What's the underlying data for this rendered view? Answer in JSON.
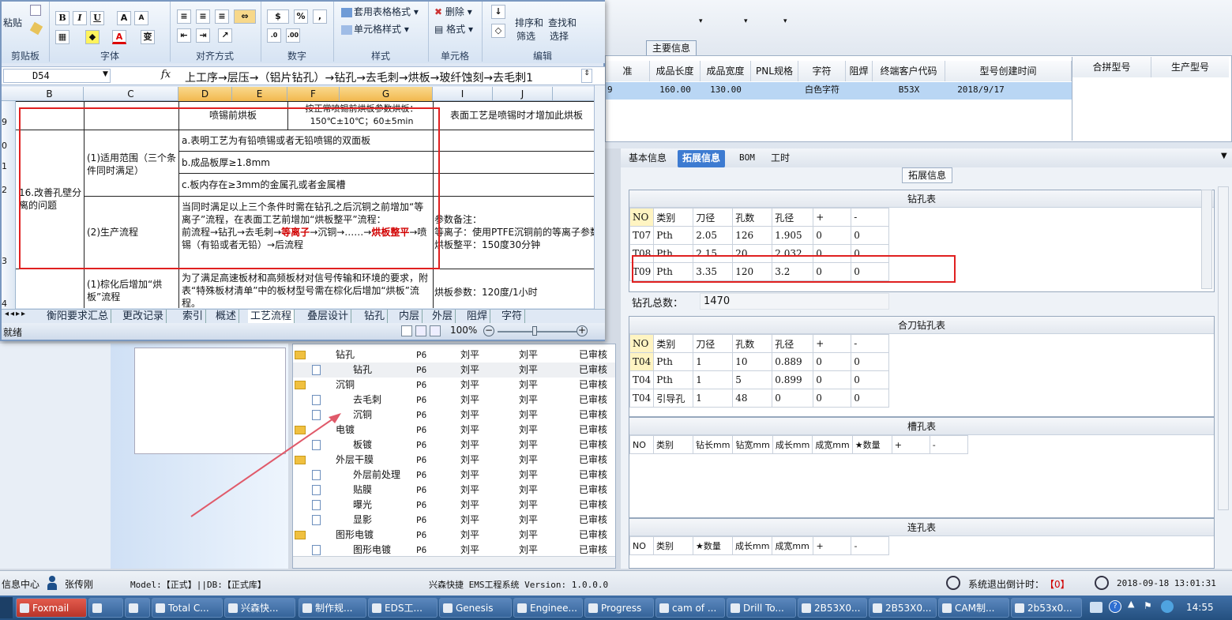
{
  "excel": {
    "ribbon": {
      "groups": [
        "剪贴板",
        "字体",
        "对齐方式",
        "数字",
        "样式",
        "单元格",
        "编辑"
      ],
      "paste_label": "粘贴",
      "table_format": "套用表格格式",
      "cell_style": "单元格样式",
      "delete": "删除",
      "format": "格式",
      "sort_filter_1": "排序和",
      "sort_filter_2": "筛选",
      "find_select_1": "查找和",
      "find_select_2": "选择"
    },
    "name_box": "D54",
    "formula": "上工序→层压→（铝片钻孔）→钻孔→去毛刺→烘板→玻纤蚀刻→去毛刺1",
    "columns": [
      "B",
      "C",
      "D",
      "E",
      "F",
      "G",
      "I",
      "J"
    ],
    "rows": [
      "9",
      "0",
      "1",
      "2",
      "3",
      "4"
    ],
    "cells": {
      "d9": "喷锡前烘板",
      "g9": "按正常喷锡前烘板参数烘板：150℃±10℃；60±5min",
      "i9": "表面工艺是喷锡时才增加此烘板",
      "b_item": "16.改善孔壁分离的问题",
      "c_scope": "(1)适用范围（三个条件同时满足）",
      "d_a": "a.表明工艺为有铅喷锡或者无铅喷锡的双面板",
      "d_b": "b.成品板厚≥1.8mm",
      "d_c": "c.板内存在≥3mm的金属孔或者金属槽",
      "c_flow": "(2)生产流程",
      "flow_text_1": "当同时满足以上三个条件时需在钻孔之后沉铜之前增加“等离子”流程，在表面工艺前增加“烘板整平”流程：",
      "flow_text_2a": "前流程→钻孔→去毛刺→",
      "flow_text_2b": "等离子",
      "flow_text_2c": "→沉铜→……→",
      "flow_text_2d": "烘板整平",
      "flow_text_2e": "→喷锡（有铅或者无铅）→后流程",
      "note": "参数备注：\n等离子：使用PTFE沉铜前的等离子参数\n烘板整平：150度30分钟",
      "c_next": "(1)棕化后增加“烘板”流程",
      "d_next": "为了满足高速板材和高频板材对信号传输和环境的要求，附表“特殊板材清单”中的板材型号需在棕化后增加“烘板”流程。",
      "i_next": "烘板参数：120度/1小时"
    },
    "sheet_tabs": [
      "衡阳要求汇总",
      "更改记录",
      "索引",
      "概述",
      "工艺流程",
      "叠层设计",
      "钻孔",
      "内层",
      "外层",
      "阻焊",
      "字符"
    ],
    "active_tab": "工艺流程",
    "status_left": "就绪",
    "zoom": "100%"
  },
  "ems": {
    "main_info_tab": "主要信息",
    "grid_headers": [
      "准",
      "成品长度",
      "成品宽度",
      "PNL规格",
      "字符",
      "阻焊",
      "终端客户代码",
      "型号创建时间"
    ],
    "grid_row": [
      "9",
      "160.00",
      "130.00",
      "",
      "白色字符",
      "",
      "B53X",
      "2018/9/17"
    ],
    "right_headers": [
      "合拼型号",
      "生产型号"
    ],
    "tabs": [
      "基本信息",
      "拓展信息",
      "BOM",
      "工时"
    ],
    "active_tab": "拓展信息",
    "ext_title": "拓展信息",
    "drill_table": {
      "title": "钻孔表",
      "headers": [
        "NO",
        "类别",
        "刀径",
        "孔数",
        "孔径",
        "+",
        "-"
      ],
      "rows": [
        [
          "T07",
          "Pth",
          "2.05",
          "126",
          "1.905",
          "0",
          "0"
        ],
        [
          "T08",
          "Pth",
          "2.15",
          "20",
          "2.032",
          "0",
          "0"
        ],
        [
          "T09",
          "Pth",
          "3.35",
          "120",
          "3.2",
          "0",
          "0"
        ]
      ]
    },
    "hole_total_label": "钻孔总数：",
    "hole_total_value": "1470",
    "combo_table": {
      "title": "合刀钻孔表",
      "headers": [
        "NO",
        "类别",
        "刀径",
        "孔数",
        "孔径",
        "+",
        "-"
      ],
      "rows": [
        [
          "T04",
          "Pth",
          "1",
          "10",
          "0.889",
          "0",
          "0"
        ],
        [
          "T04",
          "Pth",
          "1",
          "5",
          "0.899",
          "0",
          "0"
        ],
        [
          "T04",
          "引导孔",
          "1",
          "48",
          "0",
          "0",
          "0"
        ]
      ]
    },
    "slot_table": {
      "title": "槽孔表",
      "headers": [
        "NO",
        "类别",
        "钻长mm",
        "钻宽mm",
        "成长mm",
        "成宽mm",
        "★数量",
        "+",
        "-"
      ]
    },
    "link_table": {
      "title": "连孔表",
      "headers": [
        "NO",
        "类别",
        "★数量",
        "成长mm",
        "成宽mm",
        "+",
        "-"
      ]
    },
    "tree": [
      {
        "name": "钻孔",
        "folder": true,
        "indent": 1,
        "c1": "P6",
        "c2": "刘平",
        "c3": "刘平",
        "c4": "已审核"
      },
      {
        "name": "钻孔",
        "folder": false,
        "indent": 2,
        "c1": "P6",
        "c2": "刘平",
        "c3": "刘平",
        "c4": "已审核"
      },
      {
        "name": "沉铜",
        "folder": true,
        "indent": 1,
        "c1": "P6",
        "c2": "刘平",
        "c3": "刘平",
        "c4": "已审核"
      },
      {
        "name": "去毛刺",
        "folder": false,
        "indent": 2,
        "c1": "P6",
        "c2": "刘平",
        "c3": "刘平",
        "c4": "已审核"
      },
      {
        "name": "沉铜",
        "folder": false,
        "indent": 2,
        "c1": "P6",
        "c2": "刘平",
        "c3": "刘平",
        "c4": "已审核"
      },
      {
        "name": "电镀",
        "folder": true,
        "indent": 1,
        "c1": "P6",
        "c2": "刘平",
        "c3": "刘平",
        "c4": "已审核"
      },
      {
        "name": "板镀",
        "folder": false,
        "indent": 2,
        "c1": "P6",
        "c2": "刘平",
        "c3": "刘平",
        "c4": "已审核"
      },
      {
        "name": "外层干膜",
        "folder": true,
        "indent": 1,
        "c1": "P6",
        "c2": "刘平",
        "c3": "刘平",
        "c4": "已审核"
      },
      {
        "name": "外层前处理",
        "folder": false,
        "indent": 2,
        "c1": "P6",
        "c2": "刘平",
        "c3": "刘平",
        "c4": "已审核"
      },
      {
        "name": "贴膜",
        "folder": false,
        "indent": 2,
        "c1": "P6",
        "c2": "刘平",
        "c3": "刘平",
        "c4": "已审核"
      },
      {
        "name": "曝光",
        "folder": false,
        "indent": 2,
        "c1": "P6",
        "c2": "刘平",
        "c3": "刘平",
        "c4": "已审核"
      },
      {
        "name": "显影",
        "folder": false,
        "indent": 2,
        "c1": "P6",
        "c2": "刘平",
        "c3": "刘平",
        "c4": "已审核"
      },
      {
        "name": "图形电镀",
        "folder": true,
        "indent": 1,
        "c1": "P6",
        "c2": "刘平",
        "c3": "刘平",
        "c4": "已审核"
      },
      {
        "name": "图形电镀",
        "folder": false,
        "indent": 2,
        "c1": "P6",
        "c2": "刘平",
        "c3": "刘平",
        "c4": "已审核"
      }
    ],
    "status": {
      "info_center": "信息中心",
      "user": "张传刚",
      "model": "Model:【正式】||DB:【正式库】",
      "system": "兴森快捷 EMS工程系统 Version: 1.0.0.0",
      "countdown_label": "系统退出倒计时：",
      "countdown_value": "【0】",
      "datetime": "2018-09-18 13:01:31"
    }
  },
  "taskbar": {
    "items": [
      "Foxmail",
      "",
      "",
      "Total C...",
      "兴森快...",
      "制作规...",
      "EDS工...",
      "Genesis",
      "Enginee...",
      "Progress",
      "cam of ...",
      "Drill To...",
      "2B53X0...",
      "2B53X0...",
      "CAM制...",
      "2b53x0..."
    ],
    "clock": "14:55"
  },
  "colors": {
    "accent": "#3d7bd1",
    "highlight_box": "#e02020",
    "selected_row": "#b9d6f4",
    "taskbar": "#2a5a8e"
  }
}
